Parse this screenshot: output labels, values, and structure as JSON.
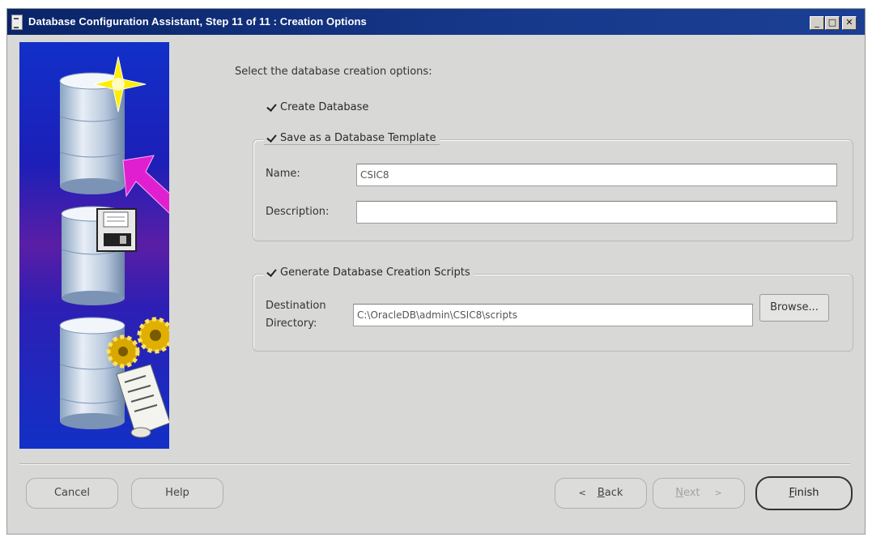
{
  "window": {
    "title": "Database Configuration Assistant, Step 11 of 11 : Creation Options",
    "controls": {
      "minimize": "_",
      "maximize": "□",
      "close": "✕"
    }
  },
  "main": {
    "prompt": "Select the database creation options:",
    "create_database": {
      "label": "Create Database",
      "checked": true
    },
    "save_template": {
      "label": "Save as a Database Template",
      "checked": true,
      "name_label": "Name:",
      "name_value": "CSIC8",
      "description_label": "Description:",
      "description_value": ""
    },
    "generate_scripts": {
      "label": "Generate Database Creation Scripts",
      "checked": true,
      "destination_label_line1": "Destination",
      "destination_label_line2": "Directory:",
      "destination_value": "C:\\OracleDB\\admin\\CSIC8\\scripts",
      "browse_label": "Browse..."
    }
  },
  "footer": {
    "cancel": "Cancel",
    "help": "Help",
    "back": {
      "arrow": "<",
      "mnemonic": "B",
      "rest": "ack"
    },
    "next": {
      "mnemonic": "N",
      "rest": "ext",
      "arrow": ">"
    },
    "finish": {
      "mnemonic": "F",
      "rest": "inish"
    }
  },
  "colors": {
    "titlebar": "#0a2468",
    "dialog_background": "#d8d8d6",
    "banner_blue": "#1130c8",
    "banner_purple": "#5a1ea6",
    "arrow_magenta": "#e020d0",
    "spark_yellow": "#ffee00",
    "gear_gold": "#d8a800"
  },
  "icons": {
    "banner": [
      "database-cylinder-icon",
      "sparkle-icon",
      "pointer-arrow-icon",
      "database-cylinder-icon",
      "floppy-disk-icon",
      "database-cylinder-icon",
      "gears-icon",
      "script-scroll-icon"
    ]
  }
}
